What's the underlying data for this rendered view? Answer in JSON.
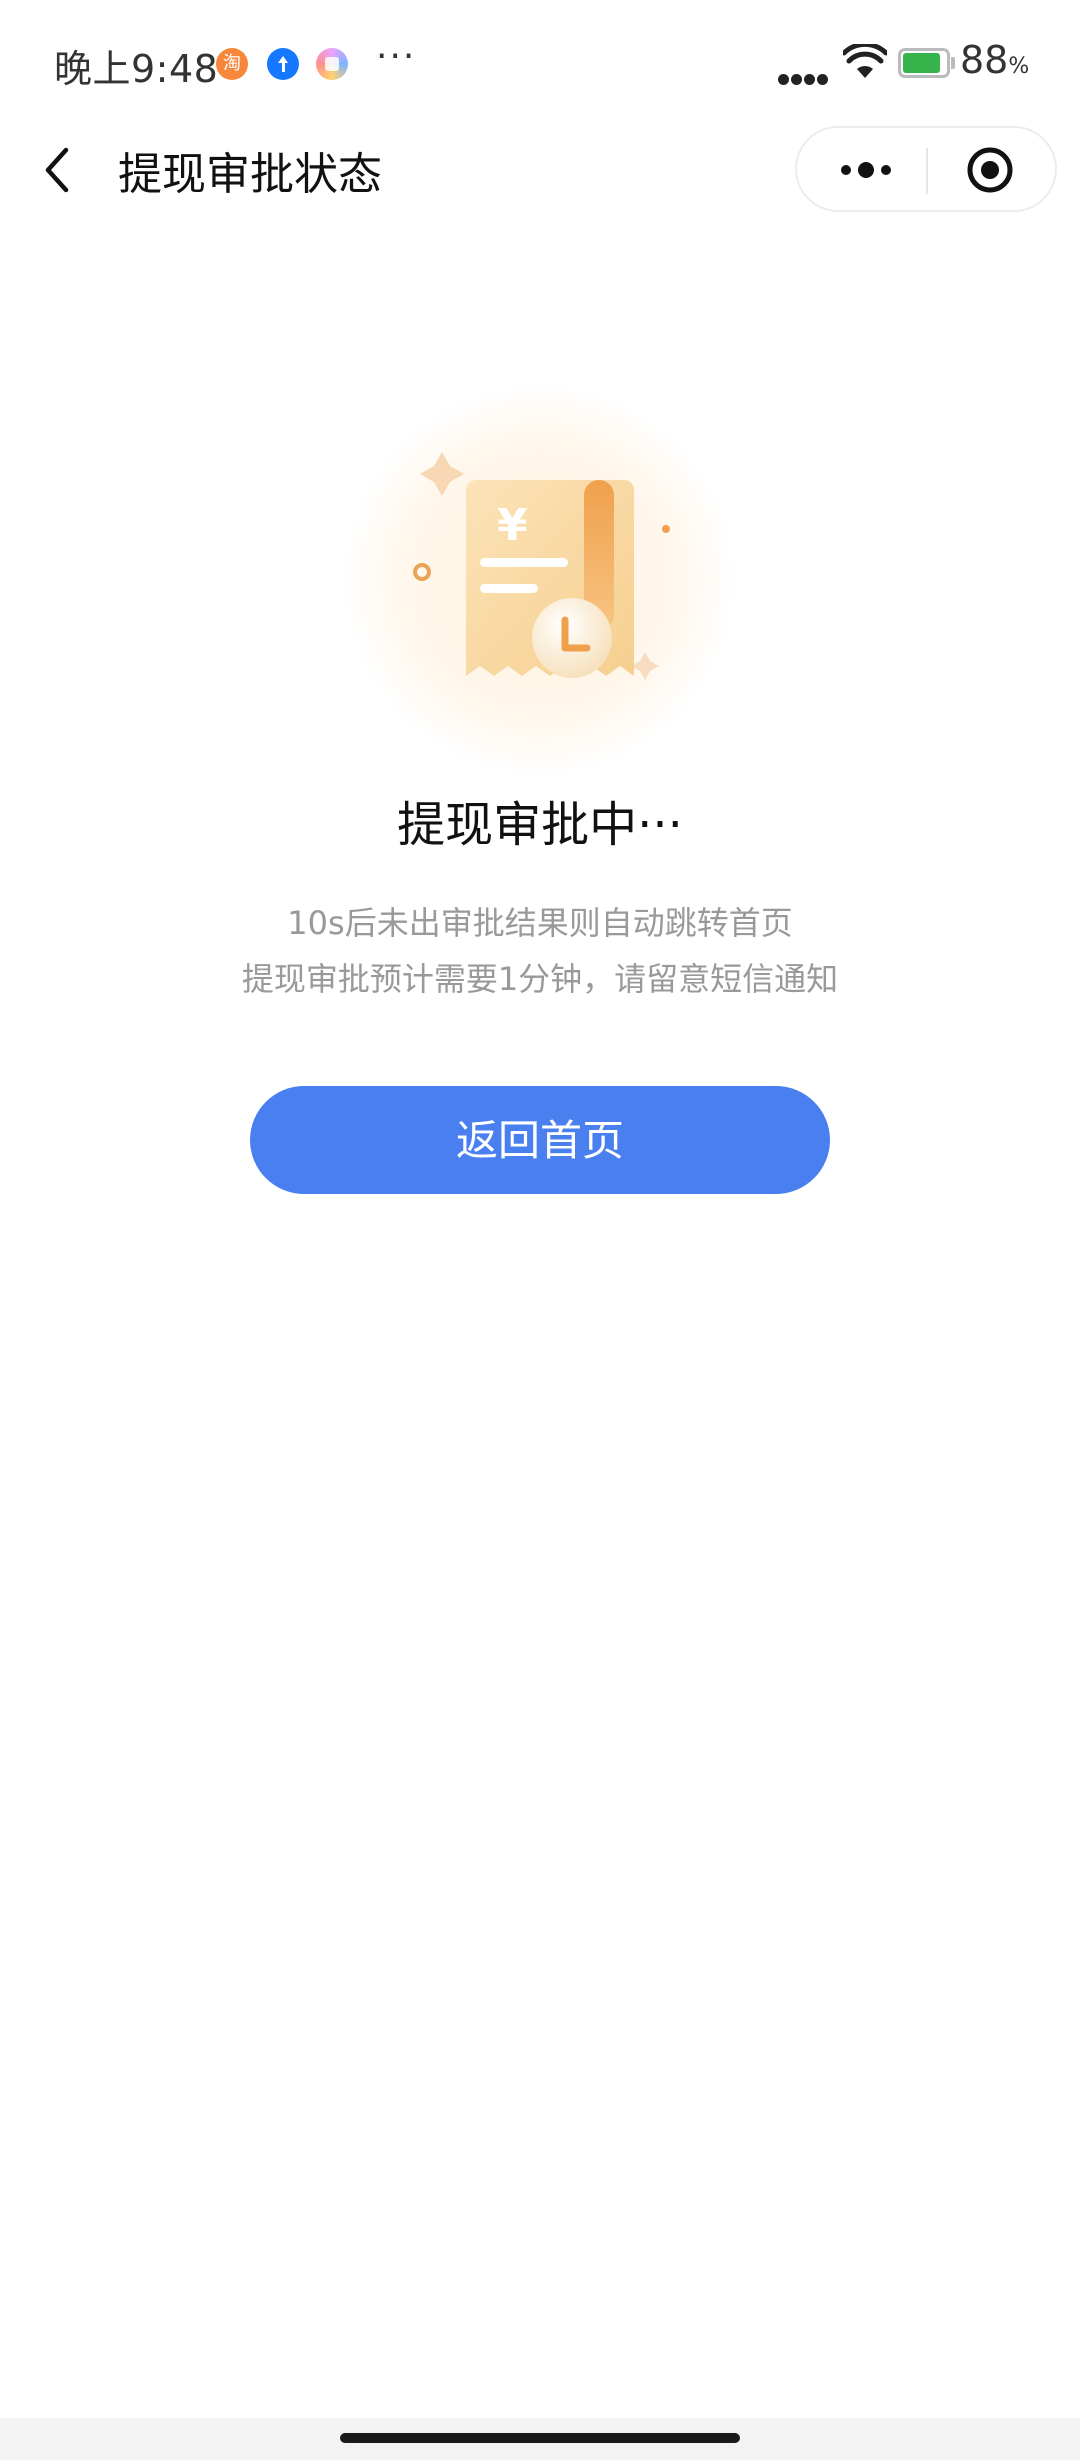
{
  "status_bar": {
    "time": "晚上9:48",
    "taobao_icon_text": "淘",
    "more_dots": "···",
    "battery_percent": "88",
    "battery_unit": "%",
    "battery_level": 0.88,
    "battery_color": "#36b34a"
  },
  "nav": {
    "title": "提现审批状态",
    "back_icon": "chevron-left-icon",
    "more_icon": "more-dots-icon",
    "close_icon": "target-close-icon"
  },
  "content": {
    "illustration_icon": "receipt-clock-icon",
    "status_title": "提现审批中···",
    "hint_line_1": "10s后未出审批结果则自动跳转首页",
    "hint_line_2": "提现审批预计需要1分钟，请留意短信通知"
  },
  "actions": {
    "home_button_label": "返回首页"
  },
  "colors": {
    "primary": "#4a7ff0",
    "hint_text": "#999999",
    "illustration_accent": "#f0a04b"
  }
}
